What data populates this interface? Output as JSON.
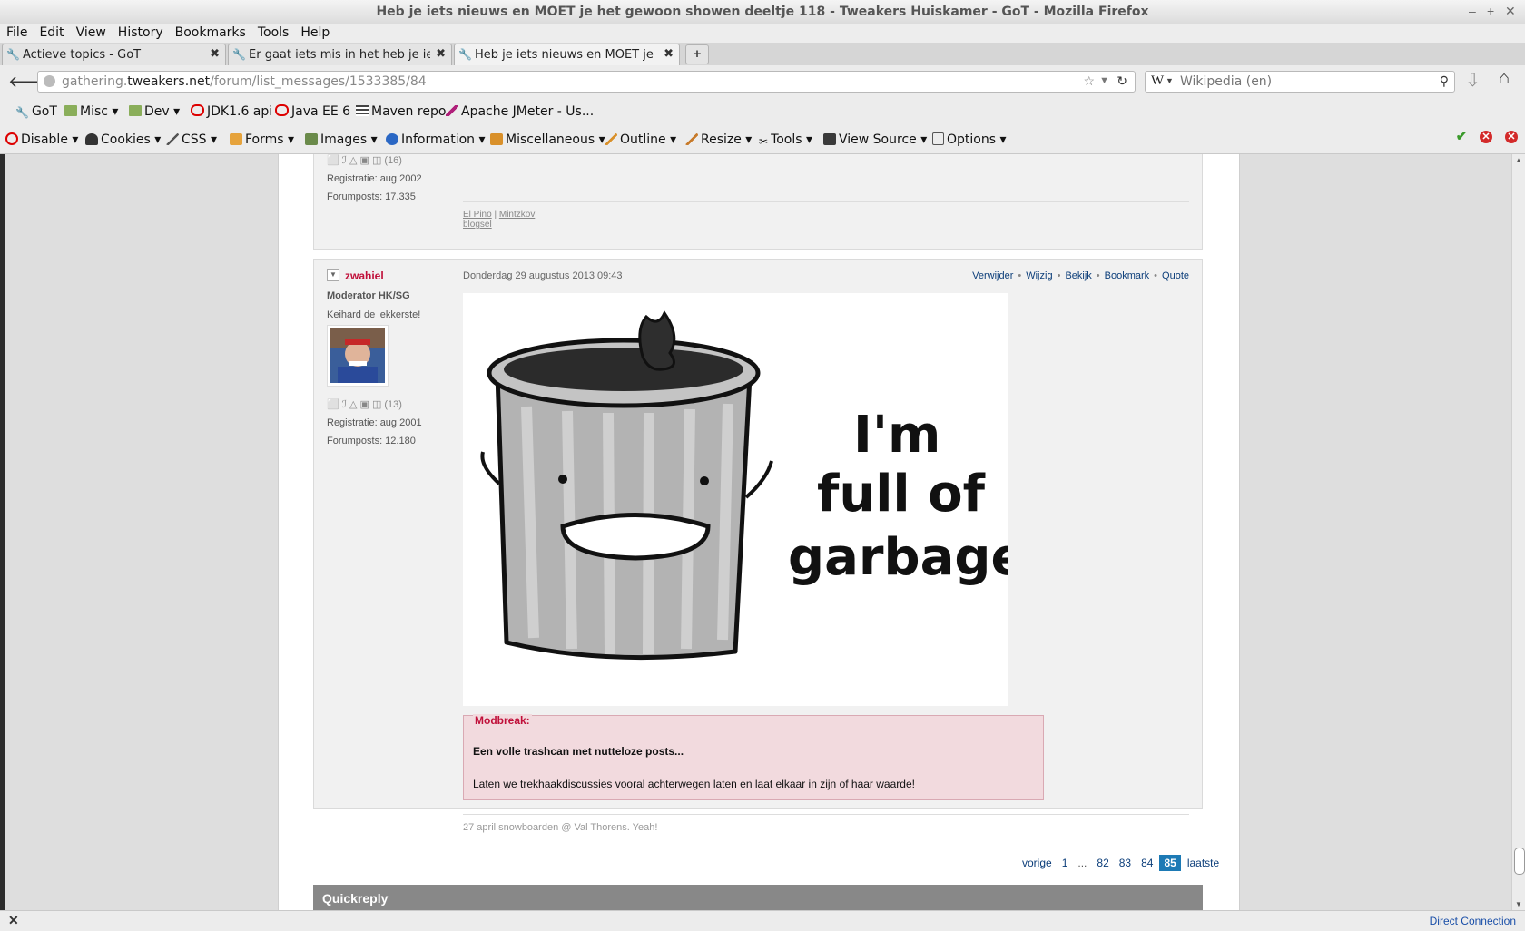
{
  "window": {
    "title": "Heb je iets nieuws en MOET je het gewoon showen deeltje 118 - Tweakers Huiskamer - GoT - Mozilla Firefox"
  },
  "menu": [
    "File",
    "Edit",
    "View",
    "History",
    "Bookmarks",
    "Tools",
    "Help"
  ],
  "tabs": [
    {
      "label": "Actieve topics - GoT",
      "active": false
    },
    {
      "label": "Er gaat iets mis in het heb je ie...",
      "active": false
    },
    {
      "label": "Heb je iets nieuws en MOET je ...",
      "active": true
    }
  ],
  "nav": {
    "url_prefix": "gathering.",
    "url_domain": "tweakers.net",
    "url_path": "/forum/list_messages/1533385/84",
    "search_placeholder": "Wikipedia (en)",
    "search_engine": "W"
  },
  "bookmarks": [
    {
      "label": "GoT",
      "icon": "wrench-icon"
    },
    {
      "label": "Misc",
      "icon": "folder-icon",
      "menu": true
    },
    {
      "label": "Dev",
      "icon": "folder-icon",
      "menu": true
    },
    {
      "label": "JDK1.6 api",
      "icon": "oracle-icon"
    },
    {
      "label": "Java EE 6",
      "icon": "oracle-icon"
    },
    {
      "label": "Maven repo",
      "icon": "page-icon"
    },
    {
      "label": "Apache JMeter - Us...",
      "icon": "feather-icon"
    }
  ],
  "webdev": [
    "Disable",
    "Cookies",
    "CSS",
    "Forms",
    "Images",
    "Information",
    "Miscellaneous",
    "Outline",
    "Resize",
    "Tools",
    "View Source",
    "Options"
  ],
  "prev_post": {
    "icons": "⬜ ℐ △ ▣ ◫ (16)",
    "registratie": "Registratie: aug 2002",
    "forumposts": "Forumposts: 17.335",
    "sig_link1": "El Pino",
    "sig_sep": "|",
    "sig_link2": "Mintzkov",
    "sig_link3": "blogsel"
  },
  "post": {
    "username": "zwahiel",
    "role": "Moderator HK/SG",
    "usertitle": "Keihard de lekkerste!",
    "icons": "⬜ ℐ △ ▣ ◫ (13)",
    "registratie": "Registratie: aug 2001",
    "forumposts": "Forumposts: 12.180",
    "date": "Donderdag 29 augustus 2013 09:43",
    "actions": [
      "Verwijder",
      "Wijzig",
      "Bekijk",
      "Bookmark",
      "Quote"
    ],
    "image_text": [
      "I'm",
      "full of",
      "garbage!"
    ],
    "modbreak": {
      "label": "Modbreak:",
      "line1": "Een volle trashcan met nutteloze posts...",
      "line2": "Laten we trekhaakdiscussies vooral achterwegen laten en laat elkaar in zijn of haar waarde!"
    },
    "signature": "27 april snowboarden @ Val Thorens. Yeah!"
  },
  "pagination": [
    "vorige",
    "1",
    "...",
    "82",
    "83",
    "84",
    "85",
    "laatste"
  ],
  "pagination_current": "85",
  "quickreply": "Quickreply",
  "status": {
    "connection": "Direct Connection"
  }
}
